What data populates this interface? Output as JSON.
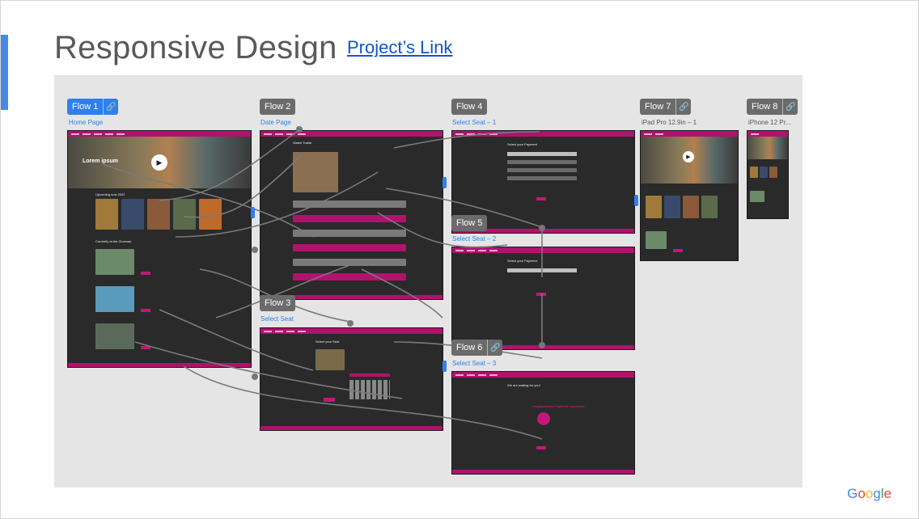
{
  "slide": {
    "title": "Responsive Design",
    "link_text": "Project’s Link",
    "brand": "Google",
    "brand_letters": [
      "G",
      "o",
      "o",
      "g",
      "l",
      "e"
    ]
  },
  "flows": [
    {
      "name": "Flow 1",
      "frame": "Home Page",
      "active": true
    },
    {
      "name": "Flow 2",
      "frame": "Date Page",
      "active": false
    },
    {
      "name": "Flow 3",
      "frame": "Select Seat",
      "active": false
    },
    {
      "name": "Flow 4",
      "frame": "Select Seat – 1",
      "active": false
    },
    {
      "name": "Flow 5",
      "frame": "Select Seat – 2",
      "active": false
    },
    {
      "name": "Flow 6",
      "frame": "Select Seat – 3",
      "active": false
    },
    {
      "name": "Flow 7",
      "frame": "iPad Pro 12.9in – 1",
      "active": false
    },
    {
      "name": "Flow 8",
      "frame": "iPhone 12 Pr...",
      "active": false
    }
  ],
  "mock": {
    "hero_heading": "Lorem ipsum",
    "upcoming": "Upcoming now 2022",
    "currently": "Currently at the Cinemas",
    "watch_trailer": "Watch Trailer",
    "select_payment": "Select your Payment",
    "select_seat": "Select your Seat",
    "waiting": "We are waiting for you!",
    "congrats": "Congratulations Payment Successful",
    "rating": "5/5"
  },
  "icons": {
    "link": "link-icon",
    "play": "play-icon"
  },
  "colors": {
    "brand_pink": "#b0126d",
    "flow_blue": "#2f80ed",
    "flow_gray": "#6b6b6b",
    "canvas": "#e5e5e5"
  }
}
